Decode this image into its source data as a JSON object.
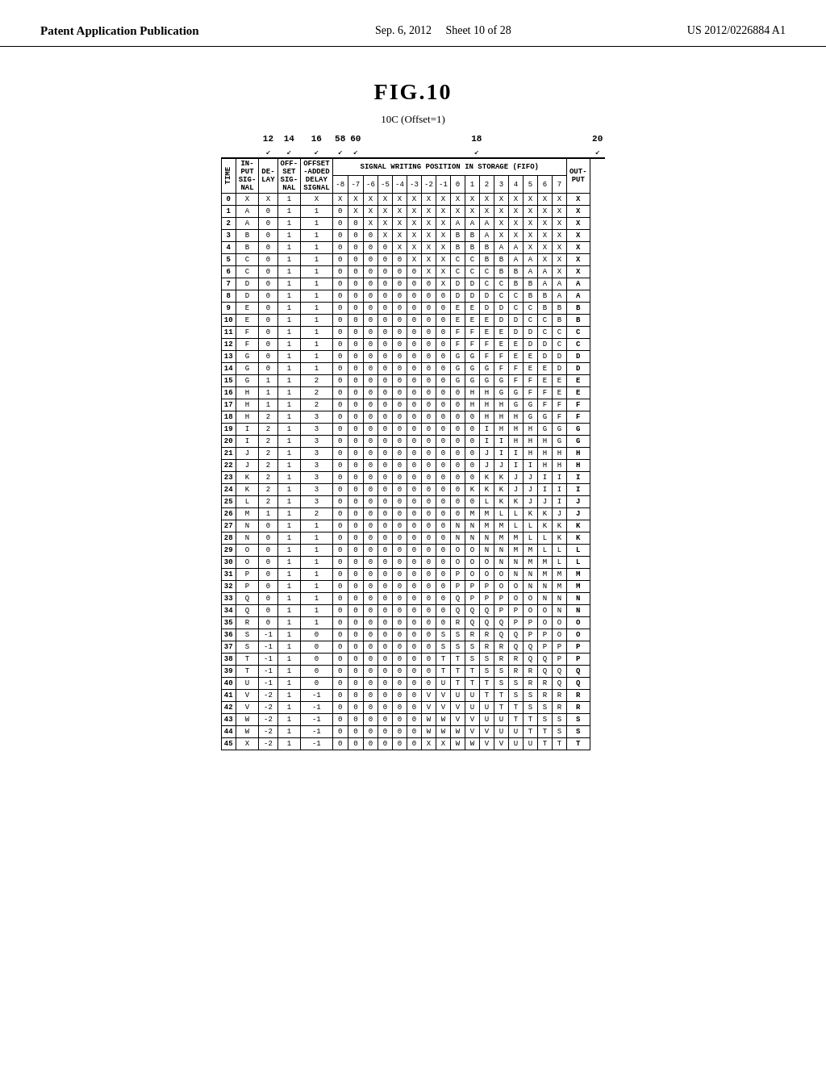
{
  "header": {
    "left": "Patent Application Publication",
    "center_date": "Sep. 6, 2012",
    "sheet": "Sheet 10 of 28",
    "patent": "US 2012/0226884 A1"
  },
  "figure": {
    "title": "FIG.10",
    "subtitle": "10C (Offset=1)"
  },
  "col_groups": {
    "group1_label": "12",
    "group2_label": "14",
    "group3_label": "16",
    "group4_label": "58",
    "group5_label": "60",
    "group6_label": "18",
    "group7_label": "20"
  },
  "col_headers": {
    "in_put": "IN-\nPUT",
    "de_lay": "DE-\nLAY",
    "off_set": "OFF-\nSET",
    "offset_added": "OFFSET\n-ADDED\nDELAY\nSIGNAL",
    "signal_writing": "SIGNAL WRITING POSITION IN STORAGE (FIFO)",
    "out_put": "OUT-\nPUT"
  },
  "sub_headers": {
    "in_put": "IN-\nPUT\nSIG-\nNAL",
    "de_lay": "DE-\nLAY",
    "off_set": "OFF-\nSET\nSIG-\nNAL",
    "signal_positions": [
      "-8",
      "-7",
      "-6",
      "-5",
      "-4",
      "-3",
      "-2",
      "-1",
      "0",
      "1",
      "2",
      "3",
      "4",
      "5",
      "6",
      "7"
    ],
    "out_put": "PUT"
  },
  "time_label": "TIME",
  "rows": [
    {
      "time": "0",
      "in": "X",
      "delay": "X",
      "offset": "1",
      "added": "X",
      "pos": [
        "X",
        "X",
        "X",
        "X",
        "X",
        "X",
        "X",
        "X",
        "X",
        "X",
        "X",
        "X",
        "X",
        "X",
        "X",
        "X"
      ],
      "out": "X"
    },
    {
      "time": "1",
      "in": "A",
      "delay": "0",
      "offset": "1",
      "added": "1",
      "pos": [
        "0",
        "X",
        "X",
        "X",
        "X",
        "X",
        "X",
        "X",
        "X",
        "X",
        "X",
        "X",
        "X",
        "X",
        "X",
        "X"
      ],
      "out": "X"
    },
    {
      "time": "2",
      "in": "A",
      "delay": "0",
      "offset": "1",
      "added": "1",
      "pos": [
        "0",
        "0",
        "X",
        "X",
        "X",
        "X",
        "X",
        "X",
        "A",
        "A",
        "A",
        "X",
        "X",
        "X",
        "X",
        "X"
      ],
      "out": "X"
    },
    {
      "time": "3",
      "in": "B",
      "delay": "0",
      "offset": "1",
      "added": "1",
      "pos": [
        "0",
        "0",
        "0",
        "X",
        "X",
        "X",
        "X",
        "X",
        "B",
        "B",
        "A",
        "X",
        "X",
        "X",
        "X",
        "X"
      ],
      "out": "X"
    },
    {
      "time": "4",
      "in": "B",
      "delay": "0",
      "offset": "1",
      "added": "1",
      "pos": [
        "0",
        "0",
        "0",
        "0",
        "X",
        "X",
        "X",
        "X",
        "B",
        "B",
        "B",
        "A",
        "A",
        "X",
        "X",
        "X"
      ],
      "out": "X"
    },
    {
      "time": "5",
      "in": "C",
      "delay": "0",
      "offset": "1",
      "added": "1",
      "pos": [
        "0",
        "0",
        "0",
        "0",
        "0",
        "X",
        "X",
        "X",
        "C",
        "C",
        "B",
        "B",
        "A",
        "A",
        "X",
        "X"
      ],
      "out": "X"
    },
    {
      "time": "6",
      "in": "C",
      "delay": "0",
      "offset": "1",
      "added": "1",
      "pos": [
        "0",
        "0",
        "0",
        "0",
        "0",
        "0",
        "X",
        "X",
        "C",
        "C",
        "C",
        "B",
        "B",
        "A",
        "A",
        "X"
      ],
      "out": "X"
    },
    {
      "time": "7",
      "in": "D",
      "delay": "0",
      "offset": "1",
      "added": "1",
      "pos": [
        "0",
        "0",
        "0",
        "0",
        "0",
        "0",
        "0",
        "X",
        "D",
        "D",
        "C",
        "C",
        "B",
        "B",
        "A",
        "A"
      ],
      "out": "A"
    },
    {
      "time": "8",
      "in": "D",
      "delay": "0",
      "offset": "1",
      "added": "1",
      "pos": [
        "0",
        "0",
        "0",
        "0",
        "0",
        "0",
        "0",
        "0",
        "D",
        "D",
        "D",
        "C",
        "C",
        "B",
        "B",
        "A"
      ],
      "out": "A"
    },
    {
      "time": "9",
      "in": "E",
      "delay": "0",
      "offset": "1",
      "added": "1",
      "pos": [
        "0",
        "0",
        "0",
        "0",
        "0",
        "0",
        "0",
        "0",
        "E",
        "E",
        "D",
        "D",
        "C",
        "C",
        "B",
        "B"
      ],
      "out": "B"
    },
    {
      "time": "10",
      "in": "E",
      "delay": "0",
      "offset": "1",
      "added": "1",
      "pos": [
        "0",
        "0",
        "0",
        "0",
        "0",
        "0",
        "0",
        "0",
        "E",
        "E",
        "E",
        "D",
        "D",
        "C",
        "C",
        "B"
      ],
      "out": "B"
    },
    {
      "time": "11",
      "in": "F",
      "delay": "0",
      "offset": "1",
      "added": "1",
      "pos": [
        "0",
        "0",
        "0",
        "0",
        "0",
        "0",
        "0",
        "0",
        "F",
        "F",
        "E",
        "E",
        "D",
        "D",
        "C",
        "C"
      ],
      "out": "C"
    },
    {
      "time": "12",
      "in": "F",
      "delay": "0",
      "offset": "1",
      "added": "1",
      "pos": [
        "0",
        "0",
        "0",
        "0",
        "0",
        "0",
        "0",
        "0",
        "F",
        "F",
        "F",
        "E",
        "E",
        "D",
        "D",
        "C"
      ],
      "out": "C"
    },
    {
      "time": "13",
      "in": "G",
      "delay": "0",
      "offset": "1",
      "added": "1",
      "pos": [
        "0",
        "0",
        "0",
        "0",
        "0",
        "0",
        "0",
        "0",
        "G",
        "G",
        "F",
        "F",
        "E",
        "E",
        "D",
        "D"
      ],
      "out": "D"
    },
    {
      "time": "14",
      "in": "G",
      "delay": "0",
      "offset": "1",
      "added": "1",
      "pos": [
        "0",
        "0",
        "0",
        "0",
        "0",
        "0",
        "0",
        "0",
        "G",
        "G",
        "G",
        "F",
        "F",
        "E",
        "E",
        "D"
      ],
      "out": "D"
    },
    {
      "time": "15",
      "in": "G",
      "delay": "1",
      "offset": "1",
      "added": "2",
      "pos": [
        "0",
        "0",
        "0",
        "0",
        "0",
        "0",
        "0",
        "0",
        "G",
        "G",
        "G",
        "G",
        "F",
        "F",
        "E",
        "E"
      ],
      "out": "E"
    },
    {
      "time": "16",
      "in": "H",
      "delay": "1",
      "offset": "1",
      "added": "2",
      "pos": [
        "0",
        "0",
        "0",
        "0",
        "0",
        "0",
        "0",
        "0",
        "0",
        "H",
        "H",
        "G",
        "G",
        "F",
        "F",
        "E"
      ],
      "out": "E"
    },
    {
      "time": "17",
      "in": "H",
      "delay": "1",
      "offset": "1",
      "added": "2",
      "pos": [
        "0",
        "0",
        "0",
        "0",
        "0",
        "0",
        "0",
        "0",
        "0",
        "H",
        "H",
        "H",
        "G",
        "G",
        "F",
        "F"
      ],
      "out": "F"
    },
    {
      "time": "18",
      "in": "H",
      "delay": "2",
      "offset": "1",
      "added": "3",
      "pos": [
        "0",
        "0",
        "0",
        "0",
        "0",
        "0",
        "0",
        "0",
        "0",
        "0",
        "H",
        "H",
        "H",
        "G",
        "G",
        "F"
      ],
      "out": "F"
    },
    {
      "time": "19",
      "in": "I",
      "delay": "2",
      "offset": "1",
      "added": "3",
      "pos": [
        "0",
        "0",
        "0",
        "0",
        "0",
        "0",
        "0",
        "0",
        "0",
        "0",
        "I",
        "H",
        "H",
        "H",
        "G",
        "G"
      ],
      "out": "G"
    },
    {
      "time": "20",
      "in": "I",
      "delay": "2",
      "offset": "1",
      "added": "3",
      "pos": [
        "0",
        "0",
        "0",
        "0",
        "0",
        "0",
        "0",
        "0",
        "0",
        "0",
        "I",
        "I",
        "H",
        "H",
        "H",
        "G"
      ],
      "out": "G"
    },
    {
      "time": "21",
      "in": "J",
      "delay": "2",
      "offset": "1",
      "added": "3",
      "pos": [
        "0",
        "0",
        "0",
        "0",
        "0",
        "0",
        "0",
        "0",
        "0",
        "0",
        "J",
        "I",
        "I",
        "H",
        "H",
        "H"
      ],
      "out": "H"
    },
    {
      "time": "22",
      "in": "J",
      "delay": "2",
      "offset": "1",
      "added": "3",
      "pos": [
        "0",
        "0",
        "0",
        "0",
        "0",
        "0",
        "0",
        "0",
        "0",
        "0",
        "J",
        "J",
        "I",
        "I",
        "H",
        "H"
      ],
      "out": "H"
    },
    {
      "time": "23",
      "in": "K",
      "delay": "2",
      "offset": "1",
      "added": "3",
      "pos": [
        "0",
        "0",
        "0",
        "0",
        "0",
        "0",
        "0",
        "0",
        "0",
        "0",
        "K",
        "K",
        "J",
        "J",
        "I",
        "I"
      ],
      "out": "I"
    },
    {
      "time": "24",
      "in": "K",
      "delay": "2",
      "offset": "1",
      "added": "3",
      "pos": [
        "0",
        "0",
        "0",
        "0",
        "0",
        "0",
        "0",
        "0",
        "0",
        "K",
        "K",
        "K",
        "J",
        "J",
        "I",
        "I"
      ],
      "out": "I"
    },
    {
      "time": "25",
      "in": "L",
      "delay": "2",
      "offset": "1",
      "added": "3",
      "pos": [
        "0",
        "0",
        "0",
        "0",
        "0",
        "0",
        "0",
        "0",
        "0",
        "0",
        "L",
        "K",
        "K",
        "J",
        "J",
        "I"
      ],
      "out": "J"
    },
    {
      "time": "26",
      "in": "M",
      "delay": "1",
      "offset": "1",
      "added": "2",
      "pos": [
        "0",
        "0",
        "0",
        "0",
        "0",
        "0",
        "0",
        "0",
        "0",
        "M",
        "M",
        "L",
        "L",
        "K",
        "K",
        "J"
      ],
      "out": "J"
    },
    {
      "time": "27",
      "in": "N",
      "delay": "0",
      "offset": "1",
      "added": "1",
      "pos": [
        "0",
        "0",
        "0",
        "0",
        "0",
        "0",
        "0",
        "0",
        "N",
        "N",
        "M",
        "M",
        "L",
        "L",
        "K",
        "K"
      ],
      "out": "K"
    },
    {
      "time": "28",
      "in": "N",
      "delay": "0",
      "offset": "1",
      "added": "1",
      "pos": [
        "0",
        "0",
        "0",
        "0",
        "0",
        "0",
        "0",
        "0",
        "N",
        "N",
        "N",
        "M",
        "M",
        "L",
        "L",
        "K"
      ],
      "out": "K"
    },
    {
      "time": "29",
      "in": "O",
      "delay": "0",
      "offset": "1",
      "added": "1",
      "pos": [
        "0",
        "0",
        "0",
        "0",
        "0",
        "0",
        "0",
        "0",
        "O",
        "O",
        "N",
        "N",
        "M",
        "M",
        "L",
        "L"
      ],
      "out": "L"
    },
    {
      "time": "30",
      "in": "O",
      "delay": "0",
      "offset": "1",
      "added": "1",
      "pos": [
        "0",
        "0",
        "0",
        "0",
        "0",
        "0",
        "0",
        "0",
        "O",
        "O",
        "O",
        "N",
        "N",
        "M",
        "M",
        "L"
      ],
      "out": "L"
    },
    {
      "time": "31",
      "in": "P",
      "delay": "0",
      "offset": "1",
      "added": "1",
      "pos": [
        "0",
        "0",
        "0",
        "0",
        "0",
        "0",
        "0",
        "0",
        "P",
        "O",
        "O",
        "O",
        "N",
        "N",
        "M",
        "M"
      ],
      "out": "M"
    },
    {
      "time": "32",
      "in": "P",
      "delay": "0",
      "offset": "1",
      "added": "1",
      "pos": [
        "0",
        "0",
        "0",
        "0",
        "0",
        "0",
        "0",
        "0",
        "P",
        "P",
        "P",
        "O",
        "O",
        "N",
        "N",
        "M"
      ],
      "out": "M"
    },
    {
      "time": "33",
      "in": "Q",
      "delay": "0",
      "offset": "1",
      "added": "1",
      "pos": [
        "0",
        "0",
        "0",
        "0",
        "0",
        "0",
        "0",
        "0",
        "Q",
        "P",
        "P",
        "P",
        "O",
        "O",
        "N",
        "N"
      ],
      "out": "N"
    },
    {
      "time": "34",
      "in": "Q",
      "delay": "0",
      "offset": "1",
      "added": "1",
      "pos": [
        "0",
        "0",
        "0",
        "0",
        "0",
        "0",
        "0",
        "0",
        "Q",
        "Q",
        "Q",
        "P",
        "P",
        "O",
        "O",
        "N"
      ],
      "out": "N"
    },
    {
      "time": "35",
      "in": "R",
      "delay": "0",
      "offset": "1",
      "added": "1",
      "pos": [
        "0",
        "0",
        "0",
        "0",
        "0",
        "0",
        "0",
        "0",
        "R",
        "Q",
        "Q",
        "Q",
        "P",
        "P",
        "O",
        "O"
      ],
      "out": "O"
    },
    {
      "time": "36",
      "in": "S",
      "delay": "-1",
      "offset": "1",
      "added": "0",
      "pos": [
        "0",
        "0",
        "0",
        "0",
        "0",
        "0",
        "0",
        "S",
        "S",
        "R",
        "R",
        "Q",
        "Q",
        "P",
        "P",
        "O"
      ],
      "out": "O"
    },
    {
      "time": "37",
      "in": "S",
      "delay": "-1",
      "offset": "1",
      "added": "0",
      "pos": [
        "0",
        "0",
        "0",
        "0",
        "0",
        "0",
        "0",
        "S",
        "S",
        "S",
        "R",
        "R",
        "Q",
        "Q",
        "P",
        "P"
      ],
      "out": "P"
    },
    {
      "time": "38",
      "in": "T",
      "delay": "-1",
      "offset": "1",
      "added": "0",
      "pos": [
        "0",
        "0",
        "0",
        "0",
        "0",
        "0",
        "0",
        "T",
        "T",
        "S",
        "S",
        "R",
        "R",
        "Q",
        "Q",
        "P"
      ],
      "out": "P"
    },
    {
      "time": "39",
      "in": "T",
      "delay": "-1",
      "offset": "1",
      "added": "0",
      "pos": [
        "0",
        "0",
        "0",
        "0",
        "0",
        "0",
        "0",
        "T",
        "T",
        "T",
        "S",
        "S",
        "R",
        "R",
        "Q",
        "Q"
      ],
      "out": "Q"
    },
    {
      "time": "40",
      "in": "U",
      "delay": "-1",
      "offset": "1",
      "added": "0",
      "pos": [
        "0",
        "0",
        "0",
        "0",
        "0",
        "0",
        "0",
        "U",
        "T",
        "T",
        "T",
        "S",
        "S",
        "R",
        "R",
        "Q"
      ],
      "out": "Q"
    },
    {
      "time": "41",
      "in": "V",
      "delay": "-2",
      "offset": "1",
      "added": "-1",
      "pos": [
        "0",
        "0",
        "0",
        "0",
        "0",
        "0",
        "V",
        "V",
        "U",
        "U",
        "T",
        "T",
        "S",
        "S",
        "R",
        "R"
      ],
      "out": "R"
    },
    {
      "time": "42",
      "in": "V",
      "delay": "-2",
      "offset": "1",
      "added": "-1",
      "pos": [
        "0",
        "0",
        "0",
        "0",
        "0",
        "0",
        "V",
        "V",
        "V",
        "U",
        "U",
        "T",
        "T",
        "S",
        "S",
        "R"
      ],
      "out": "R"
    },
    {
      "time": "43",
      "in": "W",
      "delay": "-2",
      "offset": "1",
      "added": "-1",
      "pos": [
        "0",
        "0",
        "0",
        "0",
        "0",
        "0",
        "W",
        "W",
        "V",
        "V",
        "U",
        "U",
        "T",
        "T",
        "S",
        "S"
      ],
      "out": "S"
    },
    {
      "time": "44",
      "in": "W",
      "delay": "-2",
      "offset": "1",
      "added": "-1",
      "pos": [
        "0",
        "0",
        "0",
        "0",
        "0",
        "0",
        "W",
        "W",
        "W",
        "V",
        "V",
        "U",
        "U",
        "T",
        "T",
        "S"
      ],
      "out": "S"
    },
    {
      "time": "45",
      "in": "X",
      "delay": "-2",
      "offset": "1",
      "added": "-1",
      "pos": [
        "0",
        "0",
        "0",
        "0",
        "0",
        "0",
        "X",
        "X",
        "W",
        "W",
        "V",
        "V",
        "U",
        "U",
        "T",
        "T"
      ],
      "out": "T"
    }
  ]
}
